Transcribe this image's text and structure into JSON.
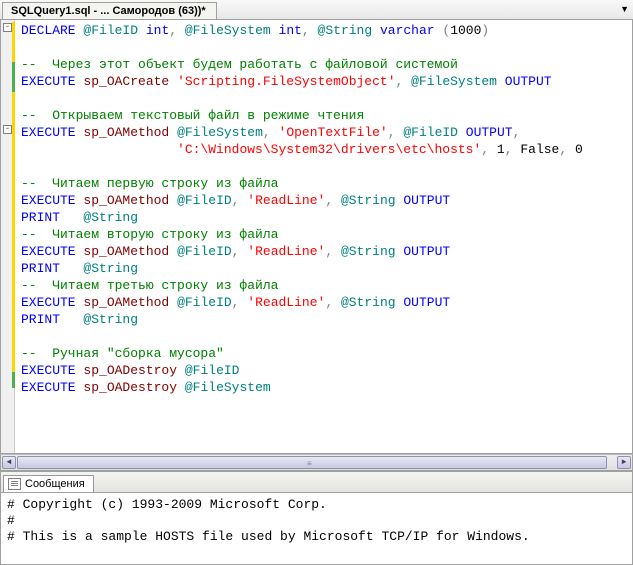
{
  "tab": {
    "title": "SQLQuery1.sql - ... Самородов (63))*"
  },
  "code": {
    "l1": {
      "declare": "DECLARE",
      "v1": "@FileID",
      "t1": "int",
      "c": ",",
      "v2": "@FileSystem",
      "t2": "int",
      "v3": "@String",
      "t3": "varchar",
      "p": "(",
      "n": "1000",
      "p2": ")"
    },
    "l2": "",
    "l3": "--  Через этот объект будем работать с файловой системой",
    "l4": {
      "exec": "EXECUTE",
      "sp": "sp_OACreate",
      "s": "'Scripting.FileSystemObject'",
      "c": ",",
      "v": "@FileSystem",
      "out": "OUTPUT"
    },
    "l5": "",
    "l6": "--  Открываем текстовый файл в режиме чтения",
    "l7": {
      "exec": "EXECUTE",
      "sp": "sp_OAMethod",
      "v": "@FileSystem",
      "c": ",",
      "s": "'OpenTextFile'",
      "v2": "@FileID",
      "out": "OUTPUT"
    },
    "l8": {
      "s": "'C:\\Windows\\System32\\drivers\\etc\\hosts'",
      "n1": "1",
      "f": "False",
      "n2": "0"
    },
    "l9": "",
    "l10": "--  Читаем первую строку из файла",
    "l11": {
      "exec": "EXECUTE",
      "sp": "sp_OAMethod",
      "v": "@FileID",
      "s": "'ReadLine'",
      "v2": "@String",
      "out": "OUTPUT"
    },
    "l12": {
      "print": "PRINT",
      "v": "@String"
    },
    "l13": "--  Читаем вторую строку из файла",
    "l14": {
      "exec": "EXECUTE",
      "sp": "sp_OAMethod",
      "v": "@FileID",
      "s": "'ReadLine'",
      "v2": "@String",
      "out": "OUTPUT"
    },
    "l15": {
      "print": "PRINT",
      "v": "@String"
    },
    "l16": "--  Читаем третью строку из файла",
    "l17": {
      "exec": "EXECUTE",
      "sp": "sp_OAMethod",
      "v": "@FileID",
      "s": "'ReadLine'",
      "v2": "@String",
      "out": "OUTPUT"
    },
    "l18": {
      "print": "PRINT",
      "v": "@String"
    },
    "l19": "",
    "l20": "--  Ручная \"сборка мусора\"",
    "l21": {
      "exec": "EXECUTE",
      "sp": "sp_OADestroy",
      "v": "@FileID"
    },
    "l22": {
      "exec": "EXECUTE",
      "sp": "sp_OADestroy",
      "v": "@FileSystem"
    }
  },
  "results": {
    "tab_label": "Сообщения",
    "lines": [
      "# Copyright (c) 1993-2009 Microsoft Corp.",
      "#",
      "# This is a sample HOSTS file used by Microsoft TCP/IP for Windows."
    ]
  }
}
